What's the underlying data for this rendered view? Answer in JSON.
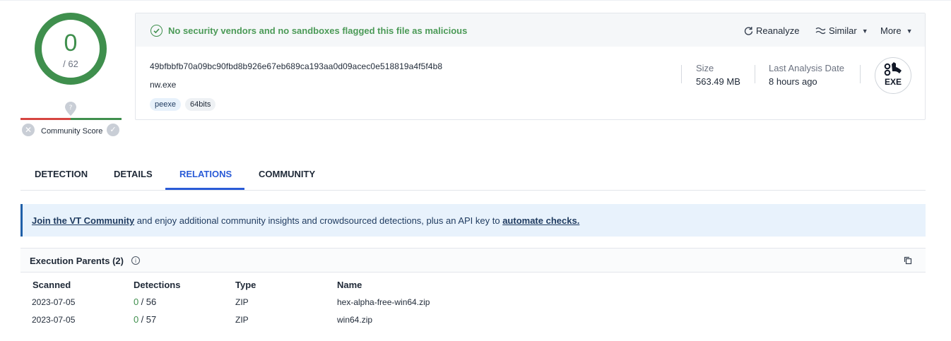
{
  "score": {
    "detections": "0",
    "total": "/ 62"
  },
  "community": {
    "label": "Community Score"
  },
  "header": {
    "status_message": "No security vendors and no sandboxes flagged this file as malicious",
    "actions": {
      "reanalyze": "Reanalyze",
      "similar": "Similar",
      "more": "More"
    }
  },
  "file": {
    "hash": "49bfbbfb70a09bc90fbd8b926e67eb689ca193aa0d09acec0e518819a4f5f4b8",
    "name": "nw.exe",
    "tags": [
      "peexe",
      "64bits"
    ],
    "size_label": "Size",
    "size_value": "563.49 MB",
    "date_label": "Last Analysis Date",
    "date_value": "8 hours ago",
    "type_badge": "EXE"
  },
  "tabs": [
    "DETECTION",
    "DETAILS",
    "RELATIONS",
    "COMMUNITY"
  ],
  "active_tab": "RELATIONS",
  "banner": {
    "link1": "Join the VT Community",
    "text": " and enjoy additional community insights and crowdsourced detections, plus an API key to ",
    "link2": "automate checks."
  },
  "execution_parents": {
    "title": "Execution Parents",
    "count": "(2)",
    "columns": [
      "Scanned",
      "Detections",
      "Type",
      "Name"
    ],
    "rows": [
      {
        "scanned": "2023-07-05",
        "det": "0",
        "det_total": "/ 56",
        "type": "ZIP",
        "name": "hex-alpha-free-win64.zip"
      },
      {
        "scanned": "2023-07-05",
        "det": "0",
        "det_total": "/ 57",
        "type": "ZIP",
        "name": "win64.zip"
      }
    ]
  },
  "colors": {
    "clean_green": "#3f8f4d",
    "accent_blue": "#2a5bd7",
    "danger_red": "#d64541"
  }
}
